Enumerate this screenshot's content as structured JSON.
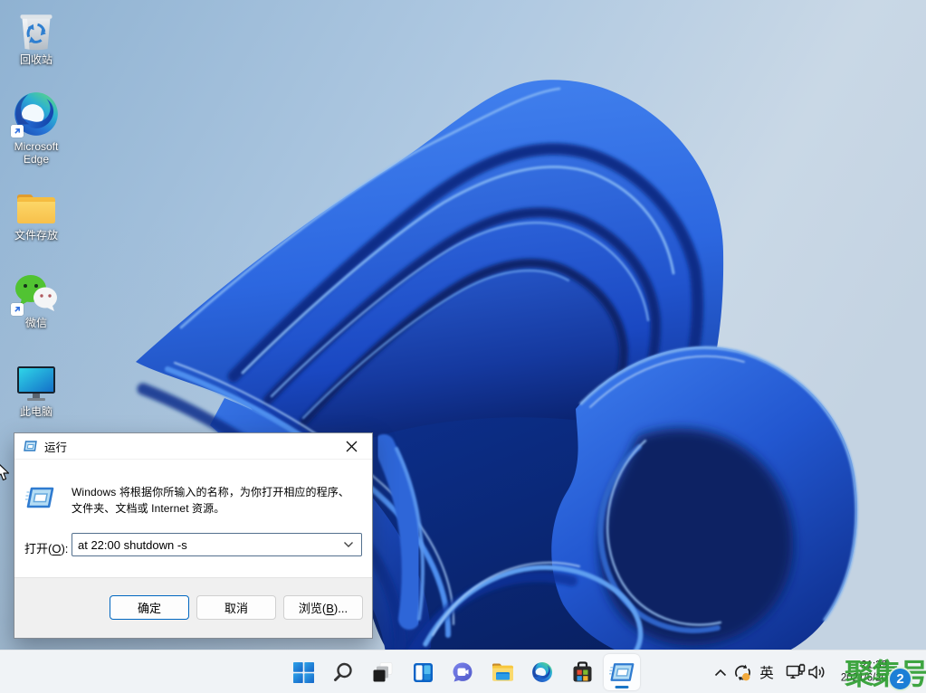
{
  "desktop_icons": [
    {
      "name": "recycle-bin",
      "label": "回收站"
    },
    {
      "name": "microsoft-edge",
      "label": "Microsoft Edge"
    },
    {
      "name": "file-folder",
      "label": "文件存放"
    },
    {
      "name": "wechat",
      "label": "微信"
    },
    {
      "name": "this-pc",
      "label": "此电脑"
    }
  ],
  "run_dialog": {
    "title": "运行",
    "description_line1": "Windows 将根据你所输入的名称，为你打开相应的程序、",
    "description_line2": "文件夹、文档或 Internet 资源。",
    "open_label": {
      "pre": "打开(",
      "accel": "O",
      "post": "):"
    },
    "input_value": "at 22:00 shutdown -s",
    "buttons": {
      "ok": "确定",
      "cancel": "取消",
      "browse": {
        "pre": "浏览(",
        "accel": "B",
        "post": ")..."
      }
    }
  },
  "taskbar": {
    "buttons": [
      "start",
      "search",
      "task-view",
      "widgets",
      "chat",
      "file-explorer",
      "edge",
      "store",
      "run-active"
    ],
    "tray": {
      "ime": "英",
      "time": "21:39",
      "date": "2021/6/20"
    }
  },
  "watermark": {
    "text": "聚集号",
    "badge": "2",
    "text_color": "#3c9e3c",
    "badge_color": "#1c7fd6"
  },
  "colors": {
    "taskbar": "#f0f3f6",
    "dialog_footer": "#f0f0f0",
    "default_button_border": "#0067c0",
    "active_pill": "#1a76c6"
  }
}
